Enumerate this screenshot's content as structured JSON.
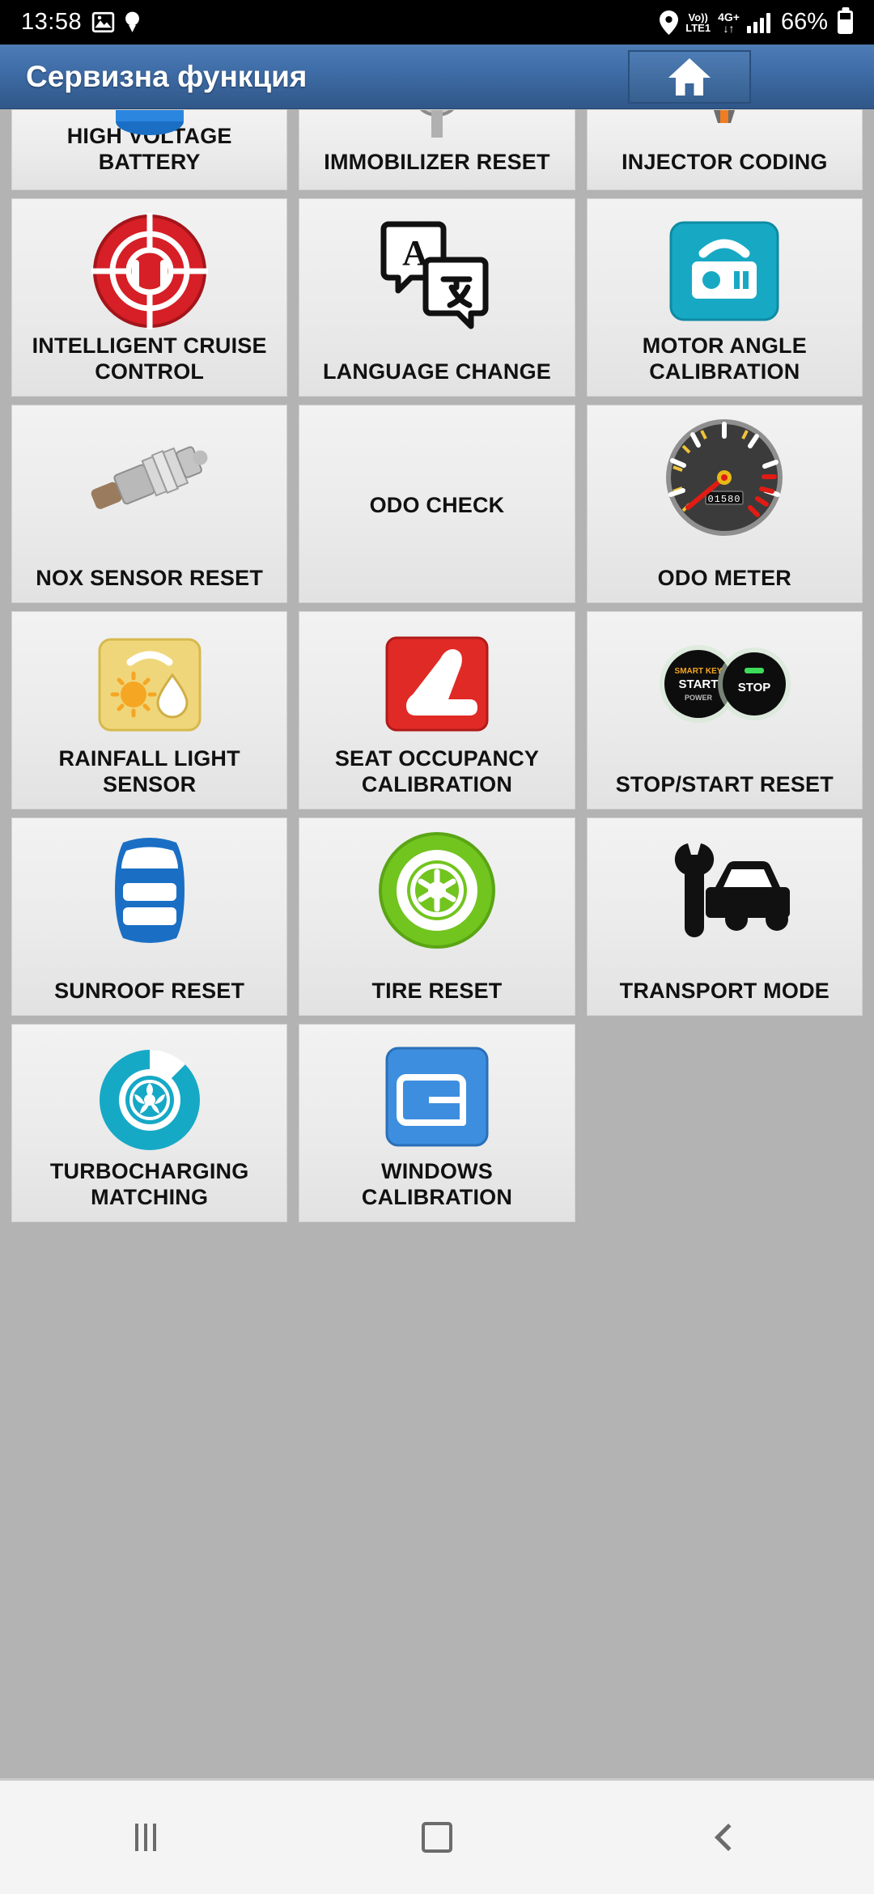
{
  "status_bar": {
    "clock": "13:58",
    "image_icon": "image-icon",
    "bulb_icon": "bulb-icon",
    "location_icon": "location-pin-icon",
    "volte_top": "Vo))",
    "volte_bottom": "LTE1",
    "network_top": "4G+",
    "network_bottom": "↓↑",
    "signal_icon": "signal-bars-icon",
    "battery_percent": "66%",
    "battery_icon": "battery-icon"
  },
  "header": {
    "title": "Сервизна функция",
    "home_button": "home-button",
    "home_icon": "home-icon",
    "bg_color": "#3f6da8"
  },
  "grid": {
    "tiles": [
      {
        "label": "HIGH VOLTAGE BATTERY",
        "icon": "high-voltage-battery-icon",
        "clipped": true
      },
      {
        "label": "IMMOBILIZER RESET",
        "icon": "immobilizer-reset-icon",
        "clipped": true
      },
      {
        "label": "INJECTOR CODING",
        "icon": "injector-coding-icon",
        "clipped": true
      },
      {
        "label": "INTELLIGENT CRUISE CONTROL",
        "icon": "intelligent-cruise-control-icon",
        "clipped": false
      },
      {
        "label": "LANGUAGE CHANGE",
        "icon": "language-change-icon",
        "clipped": false
      },
      {
        "label": "MOTOR ANGLE CALIBRATION",
        "icon": "motor-angle-calibration-icon",
        "clipped": false
      },
      {
        "label": "NOX SENSOR RESET",
        "icon": "nox-sensor-reset-icon",
        "clipped": false
      },
      {
        "label": "ODO CHECK",
        "icon": "",
        "clipped": false
      },
      {
        "label": "ODO METER",
        "icon": "odo-meter-icon",
        "clipped": false
      },
      {
        "label": "RAINFALL LIGHT SENSOR",
        "icon": "rainfall-light-sensor-icon",
        "clipped": false
      },
      {
        "label": "SEAT OCCUPANCY CALIBRATION",
        "icon": "seat-occupancy-calibration-icon",
        "clipped": false
      },
      {
        "label": "STOP/START RESET",
        "icon": "stop-start-reset-icon",
        "clipped": false
      },
      {
        "label": "SUNROOF RESET",
        "icon": "sunroof-reset-icon",
        "clipped": false
      },
      {
        "label": "TIRE RESET",
        "icon": "tire-reset-icon",
        "clipped": false
      },
      {
        "label": "TRANSPORT MODE",
        "icon": "transport-mode-icon",
        "clipped": false
      },
      {
        "label": "TURBOCHARGING MATCHING",
        "icon": "turbocharging-matching-icon",
        "clipped": false
      },
      {
        "label": "WINDOWS CALIBRATION",
        "icon": "windows-calibration-icon",
        "clipped": false
      }
    ]
  },
  "nav_bar": {
    "recents": "recents-icon",
    "home": "home-square-icon",
    "back": "back-icon"
  },
  "colors": {
    "header_blue": "#3f6da8",
    "tile_bg": "#ebebeb",
    "page_bg": "#b3b3b3",
    "cruise_red": "#d61f26",
    "motor_teal": "#17a9c4",
    "seat_red": "#e02a26",
    "sunroof_blue": "#1a6fc4",
    "tire_green": "#72c41f",
    "turbo_teal": "#16a9c6",
    "windows_blue": "#3d8ede",
    "rainfall_yellow": "#f0d67a"
  }
}
